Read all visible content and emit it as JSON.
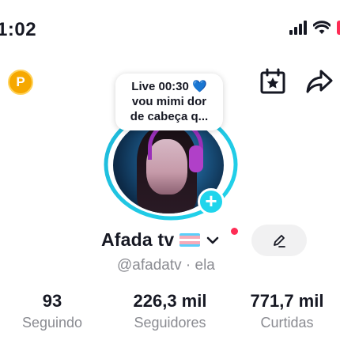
{
  "status_bar": {
    "time": "1:02",
    "battery_color": "#fe2c55"
  },
  "header": {
    "coin_letter": "P",
    "icons": [
      "coin-icon",
      "calendar-star-icon",
      "share-icon"
    ]
  },
  "live_bubble": {
    "line1": "Live 00:30",
    "heart": "💙",
    "line2": "vou mimi dor",
    "line3": "de cabeça q..."
  },
  "profile": {
    "name": "Afada tv",
    "handle": "@afadatv · ela",
    "add_symbol": "+"
  },
  "stats": [
    {
      "value": "93",
      "label": "Seguindo"
    },
    {
      "value": "226,3 mil",
      "label": "Seguidores"
    },
    {
      "value": "771,7 mil",
      "label": "Curtidas"
    }
  ],
  "colors": {
    "accent_cyan": "#20d5ec",
    "notification": "#fe2c55",
    "muted_text": "#8a8b91"
  }
}
